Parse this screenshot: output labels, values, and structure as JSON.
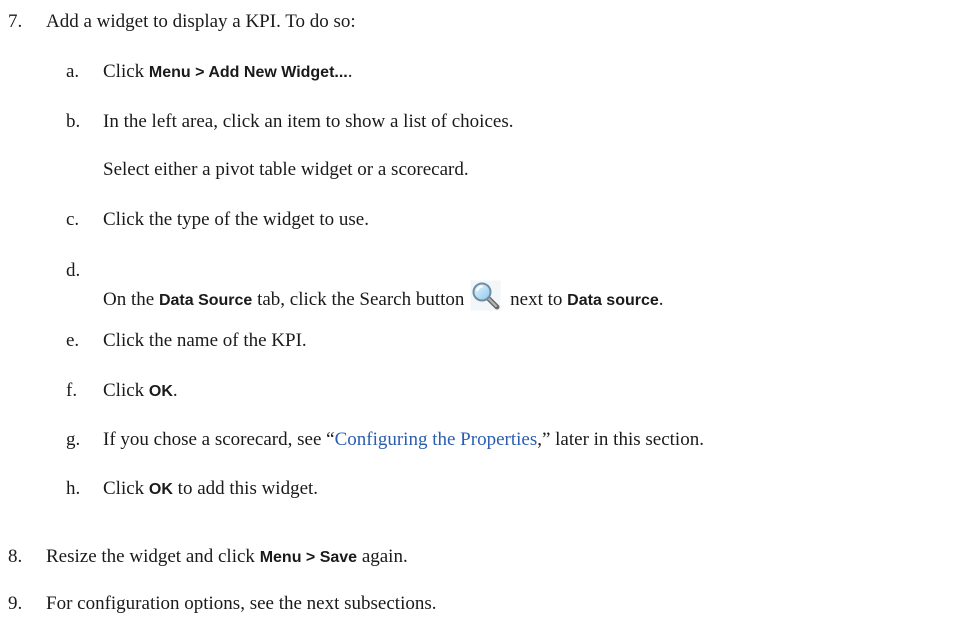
{
  "steps": [
    {
      "number": "7.",
      "text": "Add a widget to display a KPI. To do so:",
      "substeps": [
        {
          "letter": "a.",
          "pre": "Click ",
          "ui": "Menu > Add New Widget...",
          "post": "."
        },
        {
          "letter": "b.",
          "text": "In the left area, click an item to show a list of choices.",
          "continuation": "Select either a pivot table widget or a scorecard."
        },
        {
          "letter": "c.",
          "text": "Click the type of the widget to use."
        },
        {
          "letter": "d.",
          "pre": "On the ",
          "ui1": "Data Source",
          "mid": " tab, click the Search button",
          "mid2": " next to ",
          "ui2": "Data source",
          "post": "."
        },
        {
          "letter": "e.",
          "text": "Click the name of the KPI."
        },
        {
          "letter": "f.",
          "pre": "Click ",
          "ui": "OK",
          "post": "."
        },
        {
          "letter": "g.",
          "pre": "If you chose a scorecard, see “",
          "link": "Configuring the Properties",
          "post": ",” later in this section."
        },
        {
          "letter": "h.",
          "pre": "Click ",
          "ui": "OK",
          "post": " to add this widget."
        }
      ]
    },
    {
      "number": "8.",
      "pre": "Resize the widget and click ",
      "ui": "Menu > Save",
      "post": " again."
    },
    {
      "number": "9.",
      "text": "For configuration options, see the next subsections."
    }
  ],
  "icons": {
    "search_button": "magnifier-search-icon"
  }
}
